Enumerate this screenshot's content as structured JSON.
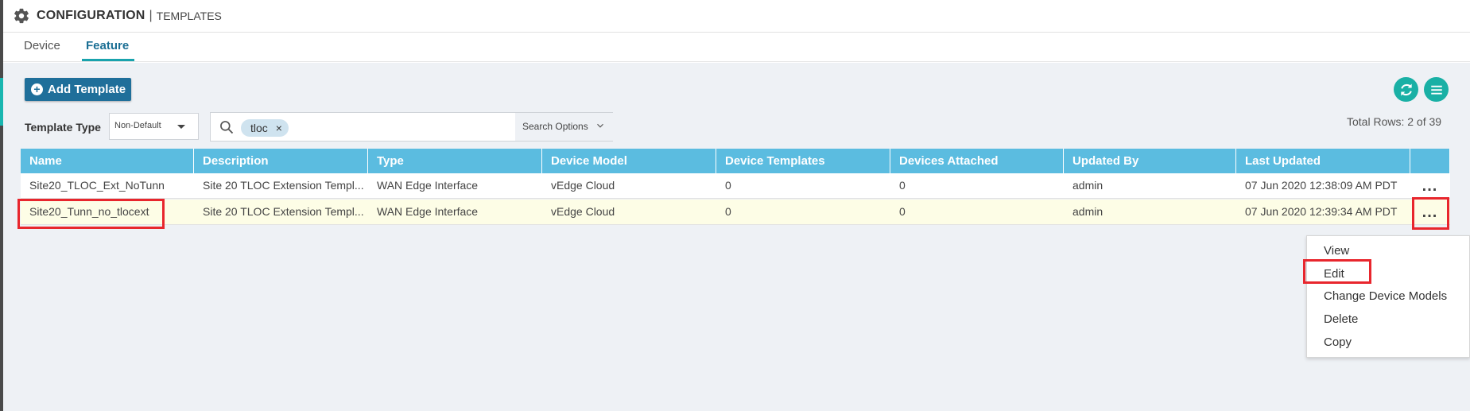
{
  "header": {
    "title": "CONFIGURATION",
    "separator": "|",
    "subtitle": "TEMPLATES",
    "icon": "gear-icon"
  },
  "tabs": [
    {
      "label": "Device",
      "active": false
    },
    {
      "label": "Feature",
      "active": true
    }
  ],
  "toolbar": {
    "add_template_label": "Add Template",
    "refresh_icon": "refresh-icon",
    "columns_icon": "list-icon",
    "accent_color": "#19b0a5",
    "primary_color": "#1f6f9a"
  },
  "filters": {
    "template_type_label": "Template Type",
    "template_type_value": "Non-Default",
    "search_chip": "tloc",
    "search_options_label": "Search Options",
    "total_rows": "Total Rows: 2 of 39"
  },
  "table": {
    "header_color": "#5bbce0",
    "columns": [
      "Name",
      "Description",
      "Type",
      "Device Model",
      "Device Templates",
      "Devices Attached",
      "Updated By",
      "Last Updated"
    ],
    "rows": [
      {
        "name": "Site20_TLOC_Ext_NoTunn",
        "description": "Site 20 TLOC Extension Templ...",
        "type": "WAN Edge Interface",
        "device_model": "vEdge Cloud",
        "device_templates": "0",
        "devices_attached": "0",
        "updated_by": "admin",
        "last_updated": "07 Jun 2020 12:38:09 AM PDT",
        "actions": "..."
      },
      {
        "name": "Site20_Tunn_no_tlocext",
        "description": "Site 20 TLOC Extension Templ...",
        "type": "WAN Edge Interface",
        "device_model": "vEdge Cloud",
        "device_templates": "0",
        "devices_attached": "0",
        "updated_by": "admin",
        "last_updated": "07 Jun 2020 12:39:34 AM PDT",
        "actions": "..."
      }
    ]
  },
  "context_menu": {
    "items": [
      "View",
      "Edit",
      "Change Device Models",
      "Delete",
      "Copy"
    ]
  },
  "highlight_color": "#e8262d"
}
